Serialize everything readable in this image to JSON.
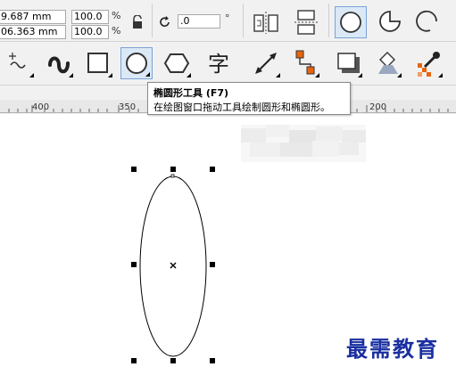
{
  "property_bar": {
    "width_value": "9.687 mm",
    "height_value": "06.363 mm",
    "scale_x_value": "100.0",
    "scale_y_value": "100.0",
    "percent_symbol": "%",
    "rotation_value": ".0",
    "degree_symbol": "°"
  },
  "ruler": {
    "labels": [
      "400",
      "350",
      "200"
    ]
  },
  "tooltip": {
    "title": "椭圆形工具 (F7)",
    "description": "在绘图窗口拖动工具绘制圆形和椭圆形。"
  },
  "watermark": "最需教育",
  "colors": {
    "accent": "#7aa3d6",
    "active_bg": "#dbe8f6",
    "watermark": "#1a2fa0",
    "fill_orange": "#e8640c"
  },
  "icons": {
    "lock": "lock-icon",
    "rotate": "rotate-icon",
    "ellipse_mode": "ellipse-mode-icon",
    "pie_mode": "pie-mode-icon",
    "arc_mode": "arc-mode-icon"
  }
}
